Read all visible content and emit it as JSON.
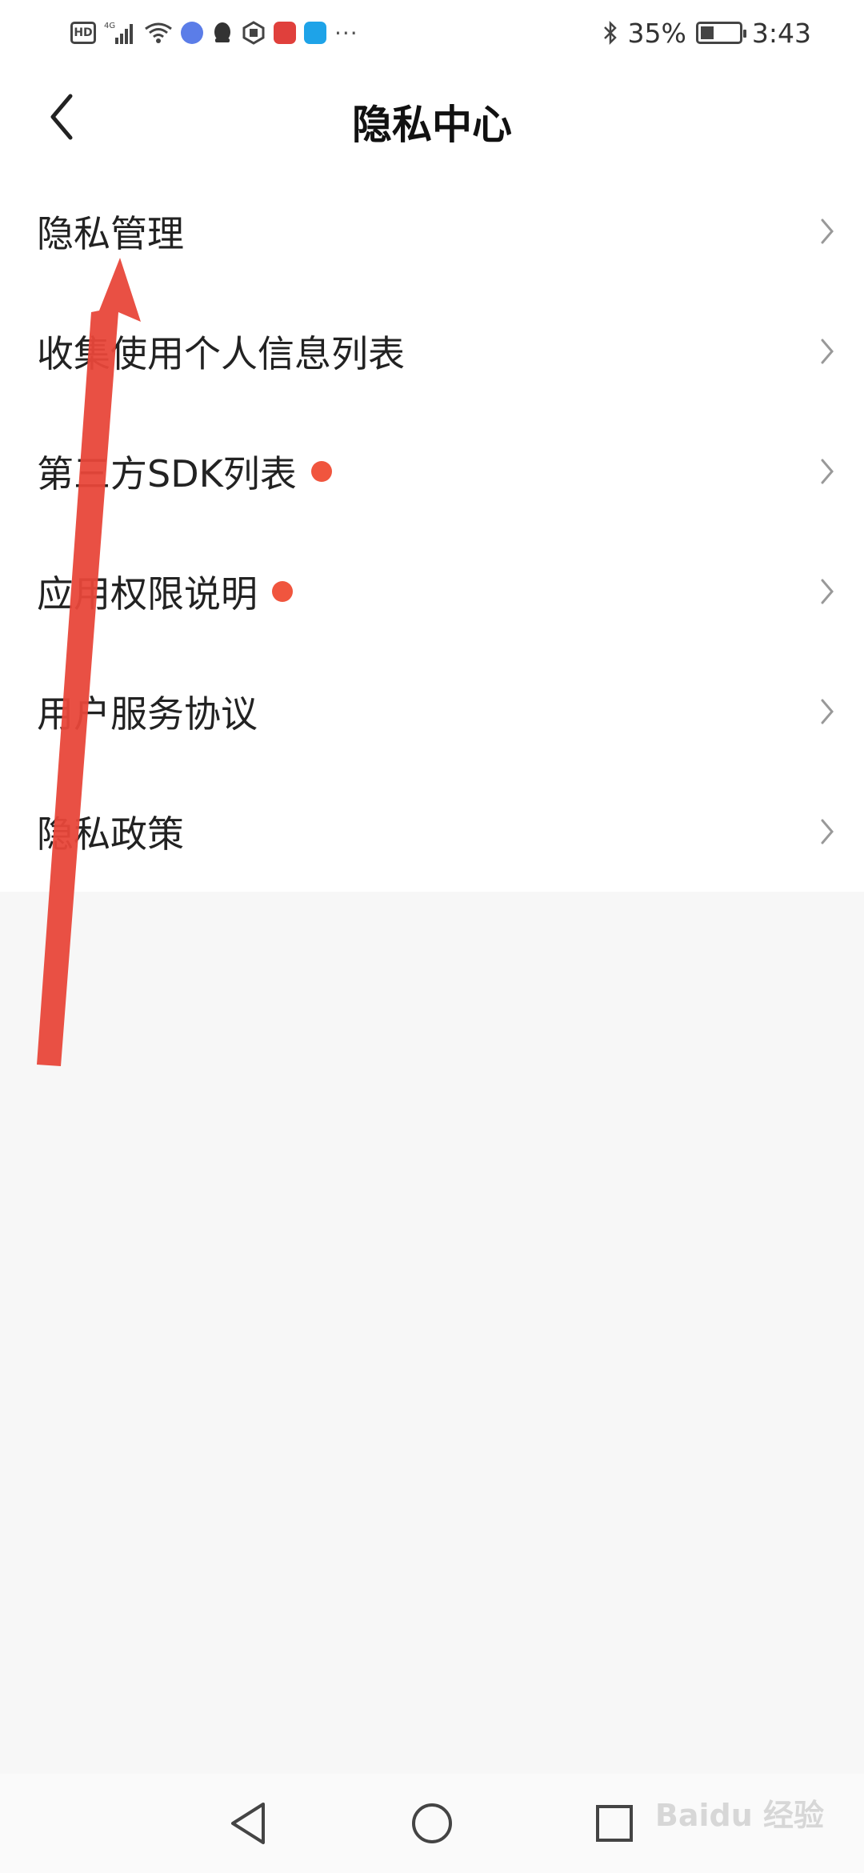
{
  "status_bar": {
    "hd": "HD",
    "network": "4G",
    "battery_percent": "35%",
    "battery_level": 0.35,
    "time": "3:43",
    "more": "···"
  },
  "header": {
    "title": "隐私中心",
    "back_icon": "chevron-left-icon"
  },
  "menu": {
    "items": [
      {
        "label": "隐私管理",
        "has_dot": false
      },
      {
        "label": "收集使用个人信息列表",
        "has_dot": false
      },
      {
        "label": "第三方SDK列表",
        "has_dot": true
      },
      {
        "label": "应用权限说明",
        "has_dot": true
      },
      {
        "label": "用户服务协议",
        "has_dot": false
      },
      {
        "label": "隐私政策",
        "has_dot": false
      }
    ]
  },
  "colors": {
    "accent_dot": "#f0553e",
    "annotation_arrow": "#e8473a"
  },
  "watermark": "Baidu 经验"
}
